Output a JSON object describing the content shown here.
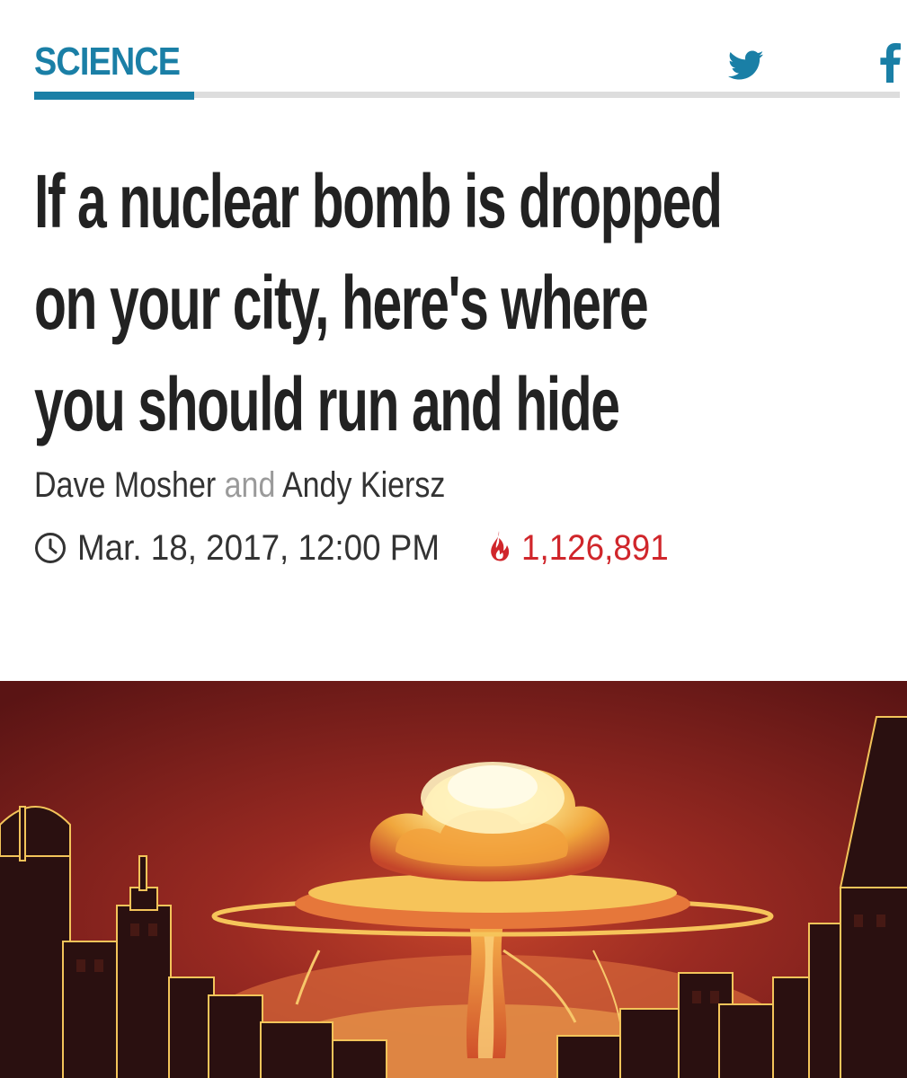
{
  "section": {
    "label": "SCIENCE",
    "accent_color": "#1a7fa6"
  },
  "share": {
    "twitter_icon": "twitter-bird-icon",
    "facebook_icon": "facebook-f-icon"
  },
  "article": {
    "headline_lines": [
      "If a nuclear bomb is dropped",
      "on your city, here's where",
      "you should run and hide"
    ],
    "authors": [
      "Dave Mosher",
      "Andy Kiersz"
    ],
    "author_joiner": "and",
    "published": "Mar. 18, 2017, 12:00 PM",
    "views": "1,126,891",
    "views_color": "#d0262b",
    "meta_icons": [
      "clock-icon",
      "flame-icon"
    ]
  },
  "hero_image": {
    "subject": "mushroom-cloud-over-city-skyline illustration"
  }
}
